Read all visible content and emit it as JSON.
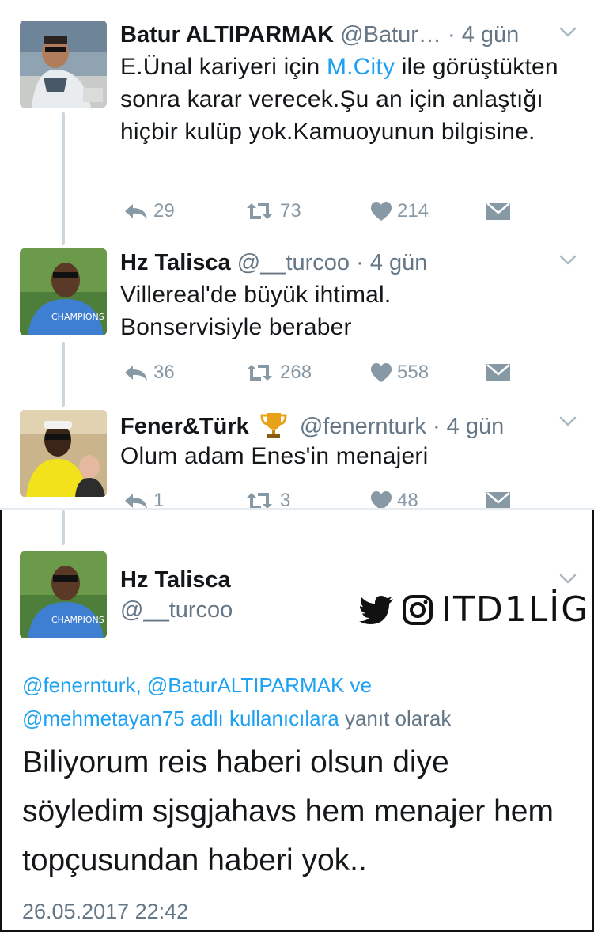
{
  "tweets": [
    {
      "name": "Batur ALTIPARMAK",
      "handle": "@Batur…",
      "time": " · 4 gün",
      "text_before_link": "E.Ünal kariyeri için ",
      "link": "M.City",
      "text_after_link": " ile görüştükten sonra karar verecek.Şu an için anlaştığı hiçbir kulüp yok.Kamuoyunun bilgisine.",
      "replies": "29",
      "retweets": "73",
      "likes": "214"
    },
    {
      "name": "Hz Talisca",
      "handle": "@__turcoo",
      "time": " · 4 gün",
      "text": "Villereal'de büyük ihtimal. Bonservisiyle beraber",
      "replies": "36",
      "retweets": "268",
      "likes": "558"
    },
    {
      "name": "Fener&Türk",
      "handle": "@fenernturk",
      "time": " · 4 gün",
      "text": "Olum adam Enes'in menajeri",
      "replies": "1",
      "retweets": "3",
      "likes": "48"
    }
  ],
  "detail": {
    "name": "Hz Talisca",
    "handle": "@__turcoo",
    "watermark": "ITD1LİG",
    "reply_line1": "@fenernturk, @BaturALTIPARMAK ve",
    "reply_line2_link": "@mehmetayan75 adlı kullanıcılara",
    "reply_line2_grey": " yanıt olarak",
    "text": "Biliyorum reis haberi olsun diye söyledim sjsgjahavs hem menajer hem topçusundan haberi yok..",
    "timestamp": "26.05.2017 22:42"
  },
  "colors": {
    "link": "#1da1f2",
    "muted": "#657786",
    "icon": "#8899a6",
    "text": "#14171a"
  },
  "icons": [
    "reply-icon",
    "retweet-icon",
    "like-icon",
    "dm-icon",
    "chevron-down-icon",
    "trophy-icon",
    "twitter-bird-icon",
    "instagram-icon"
  ]
}
